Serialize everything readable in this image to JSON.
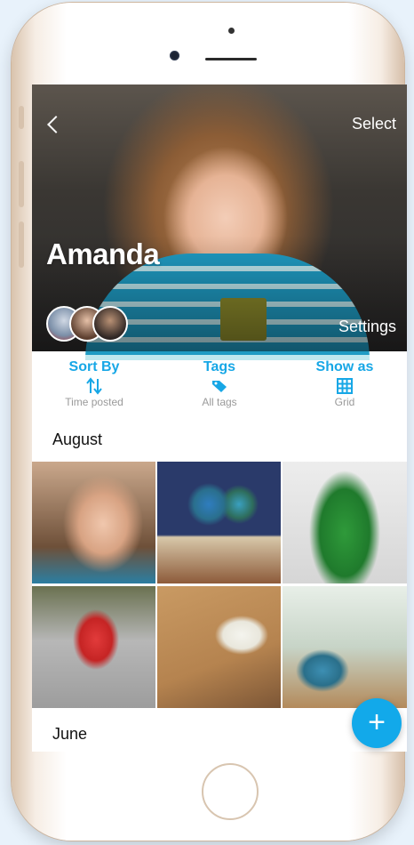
{
  "header": {
    "back_icon": "chevron-left-icon",
    "select_label": "Select",
    "profile_name": "Amanda",
    "settings_label": "Settings"
  },
  "controls": {
    "sort": {
      "label": "Sort By",
      "icon": "sort-arrows-icon",
      "value": "Time posted"
    },
    "tags": {
      "label": "Tags",
      "icon": "tag-icon",
      "value": "All tags"
    },
    "show_as": {
      "label": "Show as",
      "icon": "grid-icon",
      "value": "Grid"
    }
  },
  "sections": [
    {
      "title": "August"
    },
    {
      "title": "June"
    }
  ],
  "fab": {
    "label": "+",
    "icon": "plus-icon"
  },
  "colors": {
    "accent": "#17a7e6",
    "subtext": "#9a9a9a"
  }
}
